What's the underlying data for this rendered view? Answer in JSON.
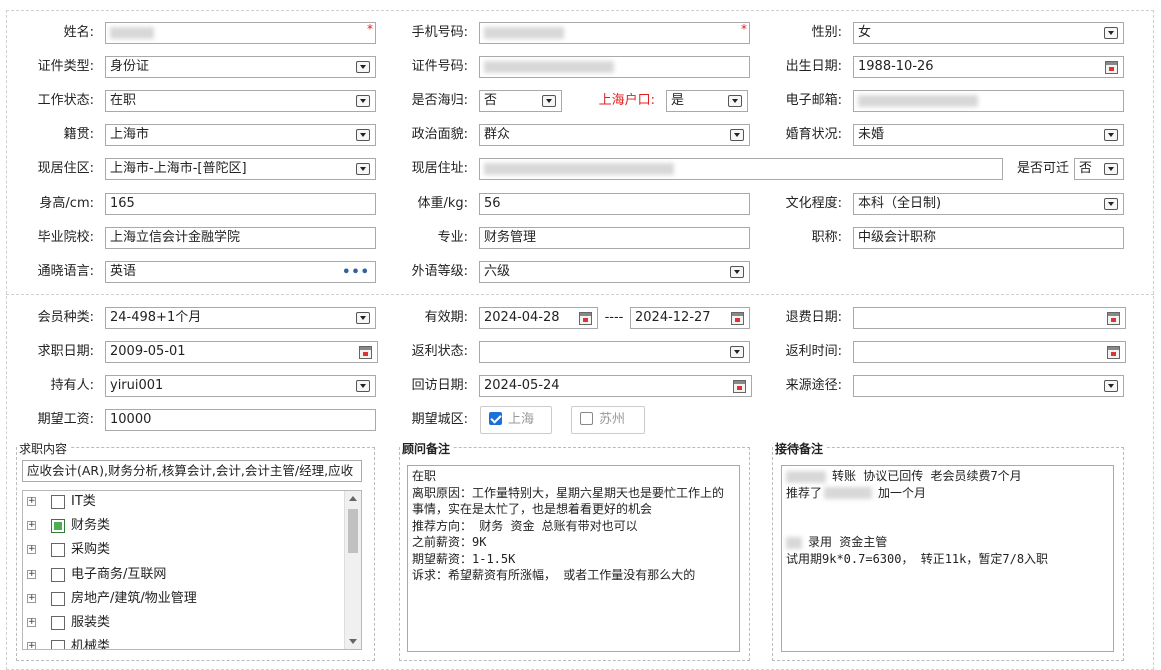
{
  "row1": {
    "name_label": "姓名:",
    "phone_label": "手机号码:",
    "gender_label": "性别:",
    "gender_value": "女"
  },
  "row2": {
    "idtype_label": "证件类型:",
    "idtype_value": "身份证",
    "idno_label": "证件号码:",
    "birth_label": "出生日期:",
    "birth_value": "1988-10-26"
  },
  "row3": {
    "work_label": "工作状态:",
    "work_value": "在职",
    "returnee_label": "是否海归:",
    "returnee_value": "否",
    "hukou_label": "上海户口:",
    "hukou_value": "是",
    "email_label": "电子邮箱:"
  },
  "row4": {
    "native_label": "籍贯:",
    "native_value": "上海市",
    "political_label": "政治面貌:",
    "political_value": "群众",
    "marital_label": "婚育状况:",
    "marital_value": "未婚"
  },
  "row5": {
    "area_label": "现居住区:",
    "area_value": "上海市-上海市-[普陀区]",
    "addr_label": "现居住址:",
    "relocate_label": "是否可迁",
    "relocate_value": "否"
  },
  "row6": {
    "height_label": "身高/cm:",
    "height_value": "165",
    "weight_label": "体重/kg:",
    "weight_value": "56",
    "edu_label": "文化程度:",
    "edu_value": "本科（全日制)"
  },
  "row7": {
    "school_label": "毕业院校:",
    "school_value": "上海立信会计金融学院",
    "major_label": "专业:",
    "major_value": "财务管理",
    "title_label": "职称:",
    "title_value": "中级会计职称"
  },
  "row8": {
    "lang_label": "通晓语言:",
    "lang_value": "英语",
    "level_label": "外语等级:",
    "level_value": "六级"
  },
  "row9": {
    "member_label": "会员种类:",
    "member_value": "24-498+1个月",
    "valid_label": "有效期:",
    "valid_from": "2024-04-28",
    "valid_sep": "----",
    "valid_to": "2024-12-27",
    "refund_label": "退费日期:"
  },
  "row10": {
    "jobdate_label": "求职日期:",
    "jobdate_value": "2009-05-01",
    "rebate_label": "返利状态:",
    "rebate_time_label": "返利时间:"
  },
  "row11": {
    "holder_label": "持有人:",
    "holder_value": "yirui001",
    "visit_label": "回访日期:",
    "visit_value": "2024-05-24",
    "source_label": "来源途径:"
  },
  "row12": {
    "salary_label": "期望工资:",
    "salary_value": "10000",
    "city_label": "期望城区:",
    "city_sh": "上海",
    "city_sz": "苏州"
  },
  "job_panel": {
    "title": "求职内容",
    "summary": "应收会计(AR),财务分析,核算会计,会计,会计主管/经理,应收",
    "items": [
      "IT类",
      "财务类",
      "采购类",
      "电子商务/互联网",
      "房地产/建筑/物业管理",
      "服装类",
      "机械类"
    ]
  },
  "advisor_panel": {
    "title": "顾问备注",
    "text": "在职\n离职原因：工作量特别大，星期六星期天也是要忙工作上的事情，实在是太忙了，也是想着看更好的机会\n推荐方向： 财务 资金 总账有带对也可以\n之前薪资：9K\n期望薪资：1-1.5K\n诉求：希望薪资有所涨幅， 或者工作量没有那么大的"
  },
  "reception_panel": {
    "title": "接待备注",
    "line1": "转账 协议已回传   老会员续费7个月",
    "line2a": "推荐了",
    "line2b": "加一个月",
    "line3": "录用  资金主管",
    "line4": "试用期9k*0.7=6300， 转正11k，暂定7/8入职"
  }
}
